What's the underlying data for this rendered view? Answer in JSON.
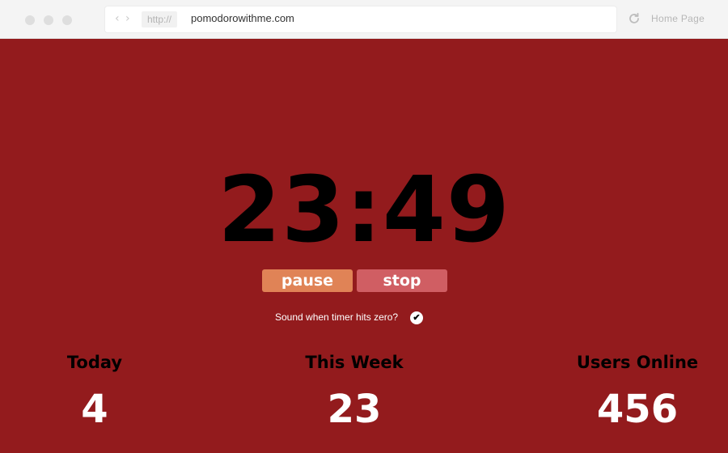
{
  "browser": {
    "back_glyph": "‹",
    "forward_glyph": "›",
    "protocol": "http://",
    "url": "pomodorowithme.com",
    "home_label": "Home Page"
  },
  "timer": {
    "display": "23:49"
  },
  "controls": {
    "pause_label": "pause",
    "stop_label": "stop",
    "sound_label": "Sound when timer hits zero?",
    "sound_checked": true,
    "check_glyph": "✔"
  },
  "stats": [
    {
      "label": "Today",
      "value": "4"
    },
    {
      "label": "This Week",
      "value": "23"
    },
    {
      "label": "Users Online",
      "value": "456"
    }
  ],
  "colors": {
    "background": "#931b1d",
    "pause_button": "#e08356",
    "stop_button": "#d05e63"
  },
  "icons": [
    "reload-icon",
    "checkmark-icon"
  ]
}
